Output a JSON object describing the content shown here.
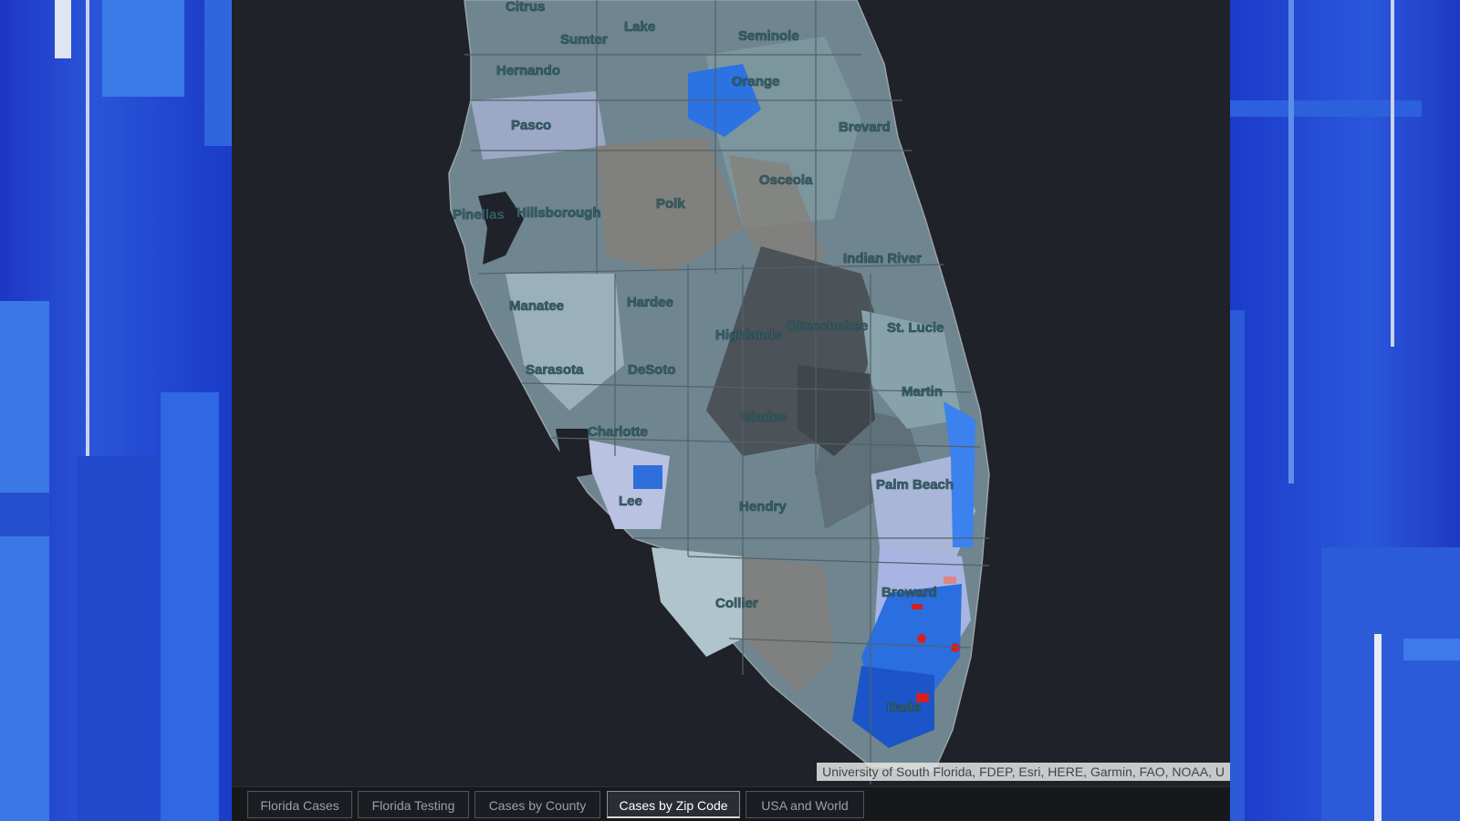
{
  "colors": {
    "background_blue": "#1b2fb0",
    "map_background": "#1f2228",
    "land_base": "#6f8590",
    "high_cases": "#1a5fd6",
    "highest_cases": "#d42020"
  },
  "map": {
    "counties": [
      "Citrus",
      "Sumter",
      "Lake",
      "Seminole",
      "Hernando",
      "Orange",
      "Pasco",
      "Brevard",
      "Osceola",
      "Polk",
      "Pinellas",
      "Hillsborough",
      "Indian River",
      "Hardee",
      "Manatee",
      "Highlands",
      "Okeechobee",
      "St. Lucie",
      "DeSoto",
      "Sarasota",
      "Martin",
      "Charlotte",
      "Glades",
      "Palm Beach",
      "Lee",
      "Hendry",
      "Broward",
      "Collier",
      "Dade"
    ],
    "attribution": "University of South Florida, FDEP, Esri, HERE, Garmin, FAO, NOAA, U"
  },
  "tabs": [
    {
      "label": "Florida Cases",
      "active": false
    },
    {
      "label": "Florida Testing",
      "active": false
    },
    {
      "label": "Cases by County",
      "active": false
    },
    {
      "label": "Cases by Zip Code",
      "active": true
    },
    {
      "label": "USA and World",
      "active": false
    }
  ]
}
